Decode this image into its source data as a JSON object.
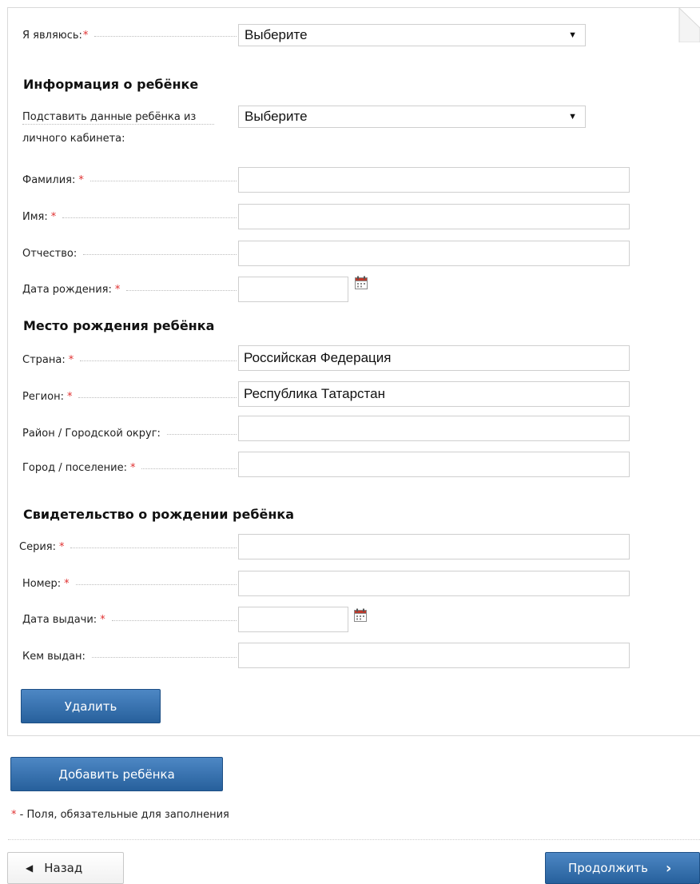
{
  "required_mark": "*",
  "i_am": {
    "label": "Я являюсь:",
    "value": "Выберите"
  },
  "child_info": {
    "heading": "Информация о ребёнке",
    "fill_from": {
      "label_line1": "Подставить данные ребёнка из",
      "label_line2": "личного кабинета:",
      "value": "Выберите"
    },
    "surname": {
      "label": "Фамилия:",
      "value": ""
    },
    "name": {
      "label": "Имя:",
      "value": ""
    },
    "patronymic": {
      "label": "Отчество:",
      "value": ""
    },
    "birth_date": {
      "label": "Дата рождения:",
      "value": ""
    }
  },
  "birthplace": {
    "heading": "Место рождения ребёнка",
    "country": {
      "label": "Страна:",
      "value": "Российская Федерация"
    },
    "region": {
      "label": "Регион:",
      "value": "Республика Татарстан"
    },
    "district": {
      "label": "Район / Городской округ:",
      "value": ""
    },
    "city": {
      "label": "Город / поселение:",
      "value": ""
    }
  },
  "certificate": {
    "heading": "Свидетельство о рождении ребёнка",
    "series": {
      "label": "Серия:",
      "value": ""
    },
    "number": {
      "label": "Номер:",
      "value": ""
    },
    "issue_date": {
      "label": "Дата выдачи:",
      "value": ""
    },
    "issued_by": {
      "label": "Кем выдан:",
      "value": ""
    }
  },
  "buttons": {
    "delete": "Удалить",
    "add_child": "Добавить ребёнка",
    "back": "Назад",
    "continue": "Продолжить"
  },
  "footnote": " - Поля, обязательные для заполнения",
  "colors": {
    "accent": "#2f6aa8",
    "required": "#e03030"
  }
}
